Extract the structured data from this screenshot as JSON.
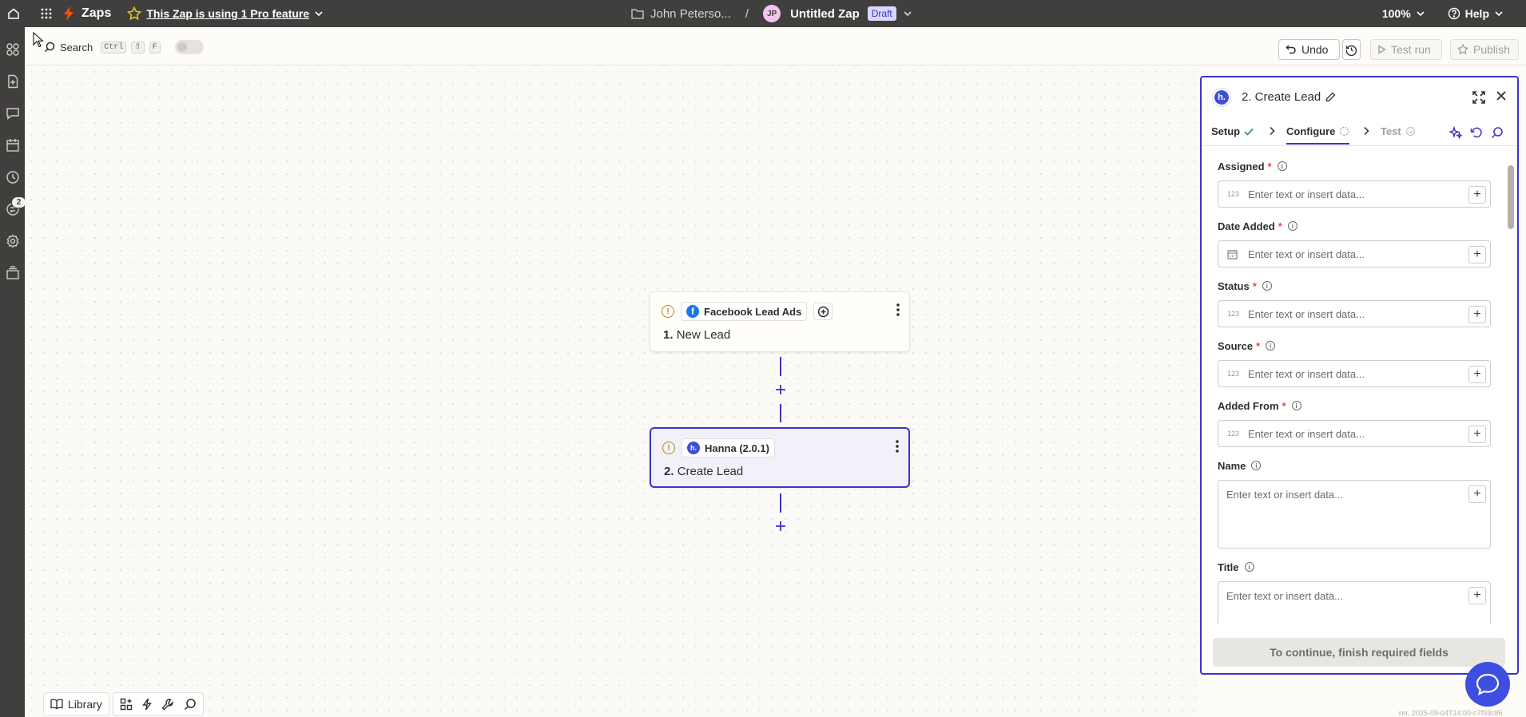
{
  "topbar": {
    "app_name": "Zaps",
    "pro_notice": "This Zap is using 1 Pro feature",
    "owner": "John Peterso...",
    "separator": "/",
    "avatar_initials": "JP",
    "zap_name": "Untitled Zap",
    "status_badge": "Draft",
    "zoom": "100%",
    "help_label": "Help"
  },
  "sidebar": {
    "notification_count": "2",
    "icons": [
      "apps-icon",
      "file-icon",
      "chat-icon",
      "calendar-icon",
      "history-icon",
      "transfer-icon",
      "settings-icon",
      "layers-icon"
    ]
  },
  "toolbar": {
    "search_label": "Search",
    "shortcut_keys": [
      "Ctrl",
      "⇧",
      "F"
    ],
    "undo_label": "Undo",
    "test_run_label": "Test run",
    "publish_label": "Publish"
  },
  "canvas": {
    "steps": [
      {
        "app": "Facebook Lead Ads",
        "number": "1.",
        "title": "New Lead"
      },
      {
        "app": "Hanna (2.0.1)",
        "number": "2.",
        "title": "Create Lead"
      }
    ]
  },
  "palette": {
    "library_label": "Library"
  },
  "panel": {
    "title": "2. Create Lead",
    "logo_text": "h.",
    "tabs": {
      "setup": "Setup",
      "configure": "Configure",
      "test": "Test"
    },
    "fields": [
      {
        "label": "Assigned",
        "required": "*",
        "type": "123",
        "placeholder": "Enter text or insert data..."
      },
      {
        "label": "Date Added",
        "required": "*",
        "type": "date",
        "placeholder": "Enter text or insert data..."
      },
      {
        "label": "Status",
        "required": "*",
        "type": "123",
        "placeholder": "Enter text or insert data..."
      },
      {
        "label": "Source",
        "required": "*",
        "type": "123",
        "placeholder": "Enter text or insert data..."
      },
      {
        "label": "Added From",
        "required": "*",
        "type": "123",
        "placeholder": "Enter text or insert data..."
      },
      {
        "label": "Name",
        "required": "",
        "type": "",
        "placeholder": "Enter text or insert data..."
      },
      {
        "label": "Title",
        "required": "",
        "type": "",
        "placeholder": "Enter text or insert data..."
      }
    ],
    "footer_label": "To continue, finish required fields"
  },
  "version": "ver. 2025-09-04T14:00-c7f93c86",
  "colors": {
    "topbar": "#403f3e",
    "accent": "#3d33c9",
    "brand": "#ff4f00",
    "required": "#e94b35"
  }
}
